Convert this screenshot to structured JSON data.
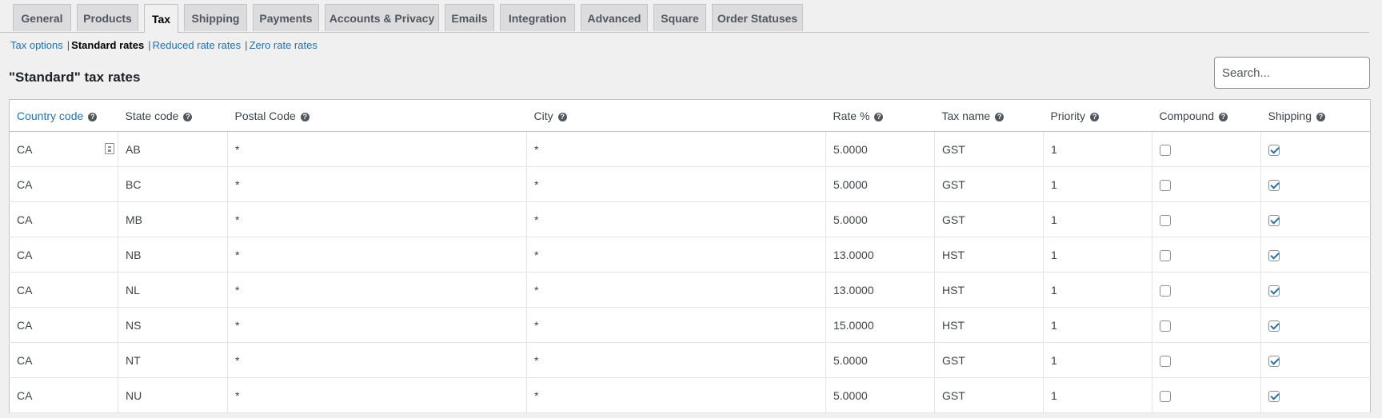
{
  "tabs": [
    "General",
    "Products",
    "Tax",
    "Shipping",
    "Payments",
    "Accounts & Privacy",
    "Emails",
    "Integration",
    "Advanced",
    "Square",
    "Order Statuses"
  ],
  "active_tab": "Tax",
  "subnav": {
    "tax_options": "Tax options",
    "standard_rates": "Standard rates",
    "reduced_rates": "Reduced rate rates",
    "zero_rates": "Zero rate rates",
    "separator": "|"
  },
  "heading": "\"Standard\" tax rates",
  "search": {
    "placeholder": "Search..."
  },
  "columns": [
    "Country code",
    "State code",
    "Postal Code",
    "City",
    "Rate %",
    "Tax name",
    "Priority",
    "Compound",
    "Shipping"
  ],
  "help_glyph": "?",
  "rows": [
    {
      "country": "CA",
      "state": "AB",
      "postal": "*",
      "city": "*",
      "rate": "5.0000",
      "name": "GST",
      "priority": "1",
      "compound": false,
      "shipping": true
    },
    {
      "country": "CA",
      "state": "BC",
      "postal": "*",
      "city": "*",
      "rate": "5.0000",
      "name": "GST",
      "priority": "1",
      "compound": false,
      "shipping": true
    },
    {
      "country": "CA",
      "state": "MB",
      "postal": "*",
      "city": "*",
      "rate": "5.0000",
      "name": "GST",
      "priority": "1",
      "compound": false,
      "shipping": true
    },
    {
      "country": "CA",
      "state": "NB",
      "postal": "*",
      "city": "*",
      "rate": "13.0000",
      "name": "HST",
      "priority": "1",
      "compound": false,
      "shipping": true
    },
    {
      "country": "CA",
      "state": "NL",
      "postal": "*",
      "city": "*",
      "rate": "13.0000",
      "name": "HST",
      "priority": "1",
      "compound": false,
      "shipping": true
    },
    {
      "country": "CA",
      "state": "NS",
      "postal": "*",
      "city": "*",
      "rate": "15.0000",
      "name": "HST",
      "priority": "1",
      "compound": false,
      "shipping": true
    },
    {
      "country": "CA",
      "state": "NT",
      "postal": "*",
      "city": "*",
      "rate": "5.0000",
      "name": "GST",
      "priority": "1",
      "compound": false,
      "shipping": true
    },
    {
      "country": "CA",
      "state": "NU",
      "postal": "*",
      "city": "*",
      "rate": "5.0000",
      "name": "GST",
      "priority": "1",
      "compound": false,
      "shipping": true
    }
  ],
  "colors": {
    "link": "#2271b1",
    "active_tab_bg": "#f0f0f1",
    "tab_bg": "#dcdcde",
    "page_bg": "#f0f0f1"
  }
}
